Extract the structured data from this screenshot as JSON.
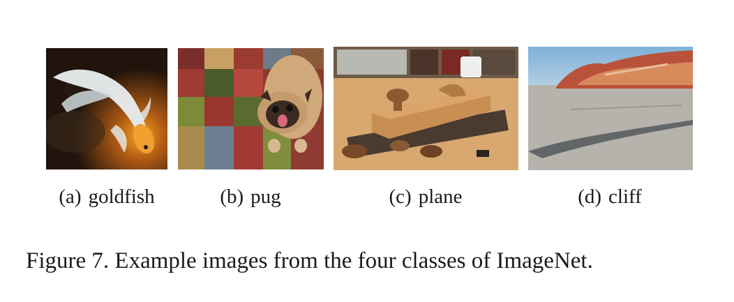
{
  "panels": [
    {
      "tag": "(a)",
      "label": "goldfish"
    },
    {
      "tag": "(b)",
      "label": "pug"
    },
    {
      "tag": "(c)",
      "label": "plane"
    },
    {
      "tag": "(d)",
      "label": "cliff"
    }
  ],
  "figure_caption": "Figure 7. Example images from the four classes of ImageNet.",
  "colors": {
    "goldfish_bg": "#2a1a10",
    "goldfish_glow": "#e08a1a",
    "rug_tan": "#c9a064",
    "wood": "#c98e52",
    "sky": "#8fb8d8",
    "cliff_red": "#b9523a",
    "sand": "#b6b3ad"
  }
}
